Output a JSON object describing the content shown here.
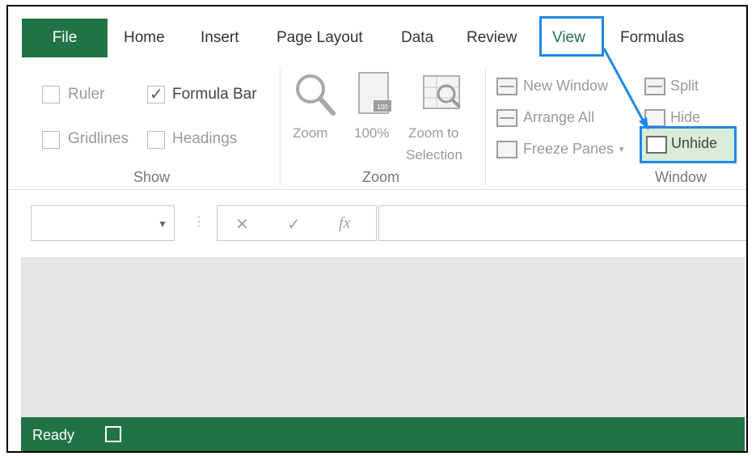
{
  "menu": {
    "file": "File",
    "tabs": [
      "Home",
      "Insert",
      "Page Layout",
      "Data",
      "Review",
      "View",
      "Formulas"
    ]
  },
  "ribbon": {
    "show": {
      "group_label": "Show",
      "ruler": "Ruler",
      "formula_bar": "Formula Bar",
      "gridlines": "Gridlines",
      "headings": "Headings"
    },
    "zoom": {
      "group_label": "Zoom",
      "zoom": "Zoom",
      "hundred": "100%",
      "zoom_to": "Zoom to",
      "selection": "Selection"
    },
    "window": {
      "group_label": "Window",
      "new_window": "New Window",
      "arrange_all": "Arrange All",
      "freeze_panes": "Freeze Panes",
      "split": "Split",
      "hide": "Hide",
      "unhide": "Unhide"
    }
  },
  "formula": {
    "cancel": "✕",
    "enter": "✓",
    "fx": "fx"
  },
  "status": {
    "ready": "Ready"
  },
  "colors": {
    "excel_green": "#217346",
    "highlight_blue": "#1e88e5"
  }
}
